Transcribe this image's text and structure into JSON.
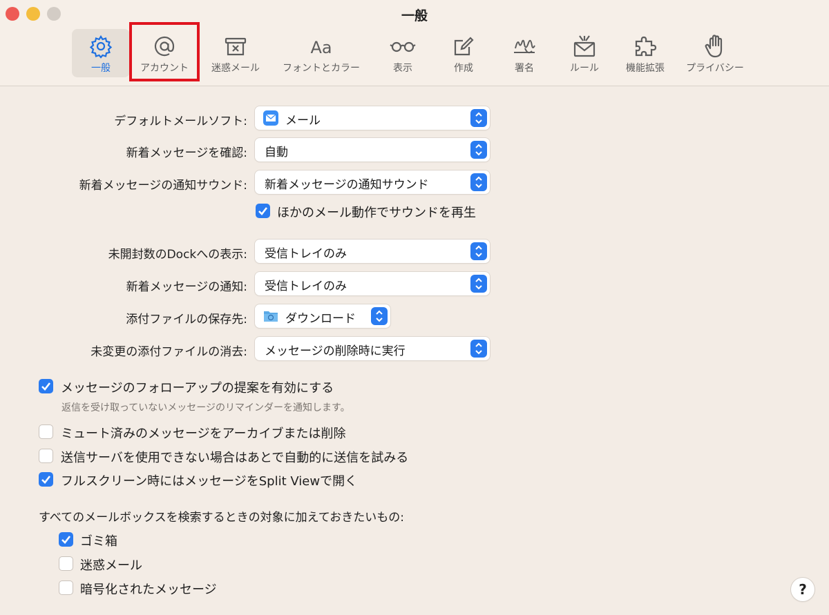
{
  "window": {
    "title": "一般"
  },
  "toolbar": {
    "items": [
      {
        "label": "一般",
        "icon": "gear-icon"
      },
      {
        "label": "アカウント",
        "icon": "at-sign-icon"
      },
      {
        "label": "迷惑メール",
        "icon": "junk-box-icon"
      },
      {
        "label": "フォントとカラー",
        "icon": "fonts-icon"
      },
      {
        "label": "表示",
        "icon": "glasses-icon"
      },
      {
        "label": "作成",
        "icon": "compose-icon"
      },
      {
        "label": "署名",
        "icon": "signature-icon"
      },
      {
        "label": "ルール",
        "icon": "rules-envelope-icon"
      },
      {
        "label": "機能拡張",
        "icon": "puzzle-icon"
      },
      {
        "label": "プライバシー",
        "icon": "hand-icon"
      }
    ],
    "aa_glyph": "Aa",
    "selected": "一般",
    "highlight_color": "#e0141e"
  },
  "settings": {
    "default_mail_label": "デフォルトメールソフト:",
    "default_mail_value": "メール",
    "check_new_label": "新着メッセージを確認:",
    "check_new_value": "自動",
    "new_sound_label": "新着メッセージの通知サウンド:",
    "new_sound_value": "新着メッセージの通知サウンド",
    "play_sounds_label": "ほかのメール動作でサウンドを再生",
    "dock_unread_label": "未開封数のDockへの表示:",
    "dock_unread_value": "受信トレイのみ",
    "new_notify_label": "新着メッセージの通知:",
    "new_notify_value": "受信トレイのみ",
    "downloads_label": "添付ファイルの保存先:",
    "downloads_value": "ダウンロード",
    "remove_attach_label": "未変更の添付ファイルの消去:",
    "remove_attach_value": "メッセージの削除時に実行"
  },
  "options": {
    "followup_label": "メッセージのフォローアップの提案を有効にする",
    "followup_sub": "返信を受け取っていないメッセージのリマインダーを通知します。",
    "muted_label": "ミュート済みのメッセージをアーカイブまたは削除",
    "retry_label": "送信サーバを使用できない場合はあとで自動的に送信を試みる",
    "splitview_label": "フルスクリーン時にはメッセージをSplit Viewで開く"
  },
  "search": {
    "heading": "すべてのメールボックスを検索するときの対象に加えておきたいもの:",
    "trash_label": "ゴミ箱",
    "junk_label": "迷惑メール",
    "encrypted_label": "暗号化されたメッセージ"
  },
  "help": {
    "label": "?"
  },
  "colors": {
    "accent": "#2a7bf0",
    "background": "#f3ece5"
  }
}
